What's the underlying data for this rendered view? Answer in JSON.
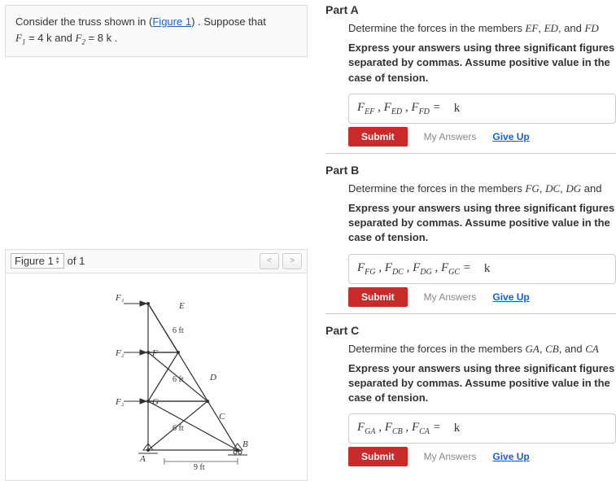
{
  "problem": {
    "pre": "Consider the truss shown in (",
    "link": "Figure 1",
    "post": ") . Suppose that",
    "eq1_var": "F",
    "eq1_sub": "1",
    "eq1_val": " = 4  k and ",
    "eq2_var": "F",
    "eq2_sub": "2",
    "eq2_val": " = 8  k ."
  },
  "figure_panel": {
    "selector": "Figure 1",
    "of": "of 1",
    "prev": "<",
    "next": ">"
  },
  "figure": {
    "F1": "F₁",
    "F2": "F₂",
    "E": "E",
    "F": "F",
    "D": "D",
    "G": "G",
    "C": "C",
    "A": "A",
    "B": "B",
    "seg": "6 ft",
    "base": "9 ft"
  },
  "parts": {
    "a": {
      "title": "Part A",
      "desc_pre": "Determine the forces in the members ",
      "m1": "EF",
      "m2": "ED",
      "m3": "FD",
      "desc_join": ", ",
      "desc_and": ", and ",
      "instr": "Express your answers using three significant figures separated by commas. Assume positive value in the case of tension.",
      "lhs": "F_{EF}, F_{ED}, F_{FD} =",
      "unit": "k",
      "submit": "Submit",
      "myans": "My Answers",
      "giveup": "Give Up"
    },
    "b": {
      "title": "Part B",
      "desc_pre": "Determine the forces in the members ",
      "m1": "FG",
      "m2": "DC",
      "m3": "DG",
      "m4": "GC",
      "desc_join": ", ",
      "desc_and": " and",
      "instr": "Express your answers using three significant figures separated by commas. Assume positive value in the case of tension.",
      "lhs": "F_{FG}, F_{DC}, F_{DG}, F_{GC} =",
      "unit": "k",
      "submit": "Submit",
      "myans": "My Answers",
      "giveup": "Give Up"
    },
    "c": {
      "title": "Part C",
      "desc_pre": "Determine the forces in the members ",
      "m1": "GA",
      "m2": "CB",
      "m3": "CA",
      "desc_join": ", ",
      "desc_and": ", and ",
      "instr": "Express your answers using three significant figures separated by commas. Assume positive value in the case of tension.",
      "lhs": "F_{GA}, F_{CB}, F_{CA} =",
      "unit": "k",
      "submit": "Submit",
      "myans": "My Answers",
      "giveup": "Give Up"
    }
  }
}
